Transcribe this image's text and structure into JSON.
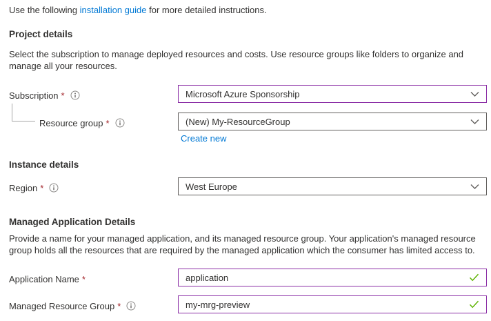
{
  "intro": {
    "pre": "Use the following ",
    "link_label": "installation guide",
    "post": " for more detailed instructions."
  },
  "project": {
    "heading": "Project details",
    "desc_lines": [
      "Select the subscription to manage deployed resources and costs. Use resource groups like folders to organize and",
      "manage all your resources."
    ],
    "subscription": {
      "label": "Subscription",
      "required": "*",
      "value": "Microsoft Azure Sponsorship"
    },
    "resource_group": {
      "label": "Resource group",
      "required": "*",
      "value": "(New) My-ResourceGroup",
      "create_new_label": "Create new"
    }
  },
  "instance": {
    "heading": "Instance details",
    "region": {
      "label": "Region",
      "required": "*",
      "value": "West Europe"
    }
  },
  "managed_app": {
    "heading": "Managed Application Details",
    "desc_lines": [
      "Provide a name for your managed application, and its managed resource group. Your application's managed resource",
      "group holds all the resources that are required by the managed application which the consumer has limited access to."
    ],
    "application_name": {
      "label": "Application Name",
      "required": "*",
      "value": "application"
    },
    "managed_resource_group": {
      "label": "Managed Resource Group",
      "required": "*",
      "value": "my-mrg-preview"
    }
  },
  "icons": {
    "info_icon": "circled-i",
    "chevron_down_icon": "chevron-down",
    "valid_check_icon": "check"
  },
  "colors": {
    "link_blue": "#0078d4",
    "edited_field_border": "#8a2da5",
    "default_field_border": "#605e5c",
    "valid_green": "#5db300",
    "required_red": "#a4262c",
    "text": "#323130"
  }
}
